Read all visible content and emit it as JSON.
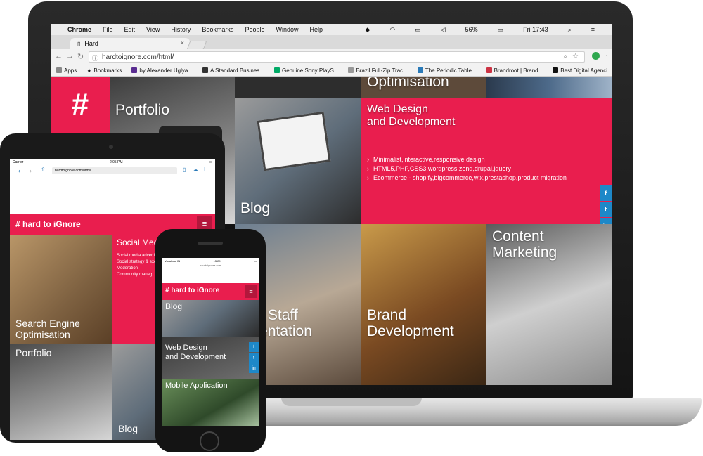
{
  "menubar": {
    "apple": "",
    "items": [
      "Chrome",
      "File",
      "Edit",
      "View",
      "History",
      "Bookmarks",
      "People",
      "Window",
      "Help"
    ],
    "battery": "56%",
    "clock": "Fri 17:43"
  },
  "browser": {
    "tab_title": "Hard",
    "url": "hardtoignore.com/html/",
    "bookmarks": [
      "Apps",
      "Bookmarks",
      "by Alexander Uglya...",
      "A Standard Busines...",
      "Genuine Sony PlayS...",
      "Brazil Full-Zip Trac...",
      "The Periodic Table...",
      "Brandroot | Brand...",
      "Best Digital Agenci..."
    ]
  },
  "site": {
    "hash_logo": "#",
    "tiles": {
      "optimisation": "Optimisation",
      "portfolio": "Portfolio",
      "blog": "Blog",
      "web_design": "Web Design\nand Development",
      "hybrid_staff": "brid Staff\ngmentation",
      "brand": "Brand\nDevelopment",
      "content": "Content\nMarketing"
    },
    "web_design_items": [
      "Minimalist,interactive,responsive design",
      "HTML5,PHP,CSS3,wordpress,zend,drupal,jquery",
      "Ecommerce - shopify,bigcommerce,wix,prestashop,product migration"
    ],
    "social": [
      "f",
      "t",
      "in"
    ]
  },
  "tablet": {
    "carrier": "Carrier",
    "time": "2:05 PM",
    "url": "hardtoignore.com/html/",
    "logo": "# hard to iGnore",
    "social_title": "Social Media Marketing",
    "social_items": [
      "Social media advertising",
      "Social strategy & execu",
      "Moderation",
      "Community manag"
    ],
    "seo": "Search Engine\nOptimisation",
    "portfolio": "Portfolio",
    "blog": "Blog"
  },
  "phone": {
    "carrier": "Vodafone IN",
    "time": "15:29",
    "url": "hardtoignore.com",
    "logo": "# hard to iGnore",
    "blog": "Blog",
    "web_design": "Web Design\nand Development",
    "mobile": "Mobile Application"
  },
  "colors": {
    "brand": "#e91e4e",
    "social": "#1e88c8"
  }
}
